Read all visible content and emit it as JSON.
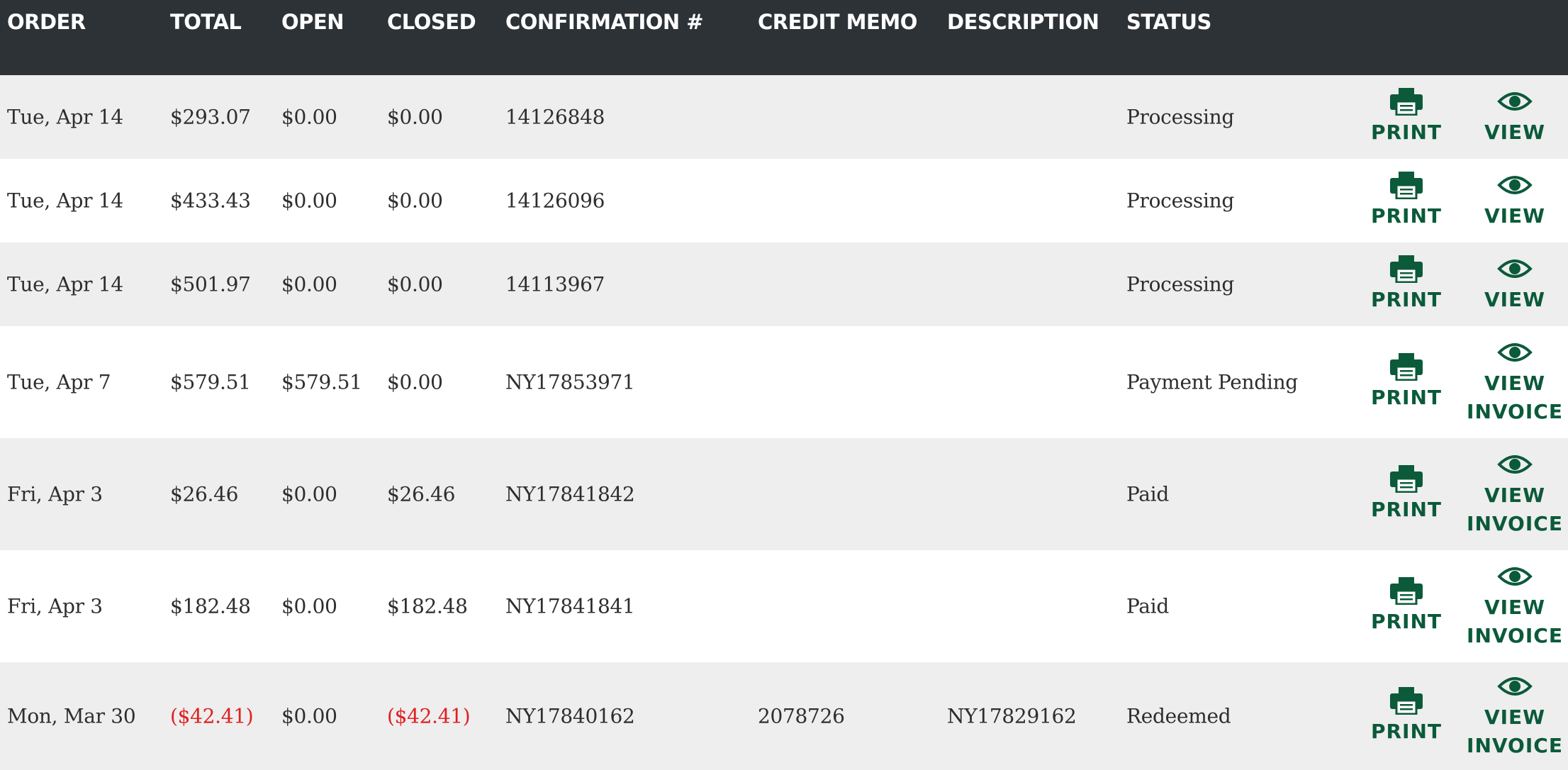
{
  "colors": {
    "header_bg": "#2d3236",
    "row_shaded": "#eeeeee",
    "row_plain": "#ffffff",
    "text": "#2e2e2e",
    "negative": "#e02020",
    "action": "#0b5a3a"
  },
  "table": {
    "headers": {
      "order": "ORDER",
      "total": "TOTAL",
      "open": "OPEN",
      "closed": "CLOSED",
      "confirmation": "CONFIRMATION #",
      "credit_memo": "CREDIT MEMO",
      "description": "DESCRIPTION",
      "status": "STATUS"
    },
    "rows": [
      {
        "order": "Tue, Apr 14",
        "total": "$293.07",
        "open": "$0.00",
        "closed": "$0.00",
        "confirmation": "14126848",
        "credit_memo": "",
        "description": "",
        "status": "Processing",
        "print_label": "PRINT",
        "print_icon": "printer-icon",
        "view_label": "VIEW",
        "view_label_2": "",
        "view_icon": "eye-icon"
      },
      {
        "order": "Tue, Apr 14",
        "total": "$433.43",
        "open": "$0.00",
        "closed": "$0.00",
        "confirmation": "14126096",
        "credit_memo": "",
        "description": "",
        "status": "Processing",
        "print_label": "PRINT",
        "print_icon": "printer-icon",
        "view_label": "VIEW",
        "view_label_2": "",
        "view_icon": "eye-icon"
      },
      {
        "order": "Tue, Apr 14",
        "total": "$501.97",
        "open": "$0.00",
        "closed": "$0.00",
        "confirmation": "14113967",
        "credit_memo": "",
        "description": "",
        "status": "Processing",
        "print_label": "PRINT",
        "print_icon": "printer-icon",
        "view_label": "VIEW",
        "view_label_2": "",
        "view_icon": "eye-icon"
      },
      {
        "order": "Tue, Apr 7",
        "total": "$579.51",
        "open": "$579.51",
        "closed": "$0.00",
        "confirmation": "NY17853971",
        "credit_memo": "",
        "description": "",
        "status": "Payment Pending",
        "print_label": "PRINT",
        "print_icon": "printer-icon",
        "view_label": "VIEW",
        "view_label_2": "INVOICE",
        "view_icon": "eye-icon"
      },
      {
        "order": "Fri, Apr 3",
        "total": "$26.46",
        "open": "$0.00",
        "closed": "$26.46",
        "confirmation": "NY17841842",
        "credit_memo": "",
        "description": "",
        "status": "Paid",
        "print_label": "PRINT",
        "print_icon": "printer-icon",
        "view_label": "VIEW",
        "view_label_2": "INVOICE",
        "view_icon": "eye-icon"
      },
      {
        "order": "Fri, Apr 3",
        "total": "$182.48",
        "open": "$0.00",
        "closed": "$182.48",
        "confirmation": "NY17841841",
        "credit_memo": "",
        "description": "",
        "status": "Paid",
        "print_label": "PRINT",
        "print_icon": "printer-icon",
        "view_label": "VIEW",
        "view_label_2": "INVOICE",
        "view_icon": "eye-icon"
      },
      {
        "order": "Mon, Mar 30",
        "total": "($42.41)",
        "open": "$0.00",
        "closed": "($42.41)",
        "confirmation": "NY17840162",
        "credit_memo": "2078726",
        "description": "NY17829162",
        "status": "Redeemed",
        "print_label": "PRINT",
        "print_icon": "printer-icon",
        "view_label": "VIEW",
        "view_label_2": "INVOICE",
        "view_icon": "eye-icon"
      }
    ]
  }
}
